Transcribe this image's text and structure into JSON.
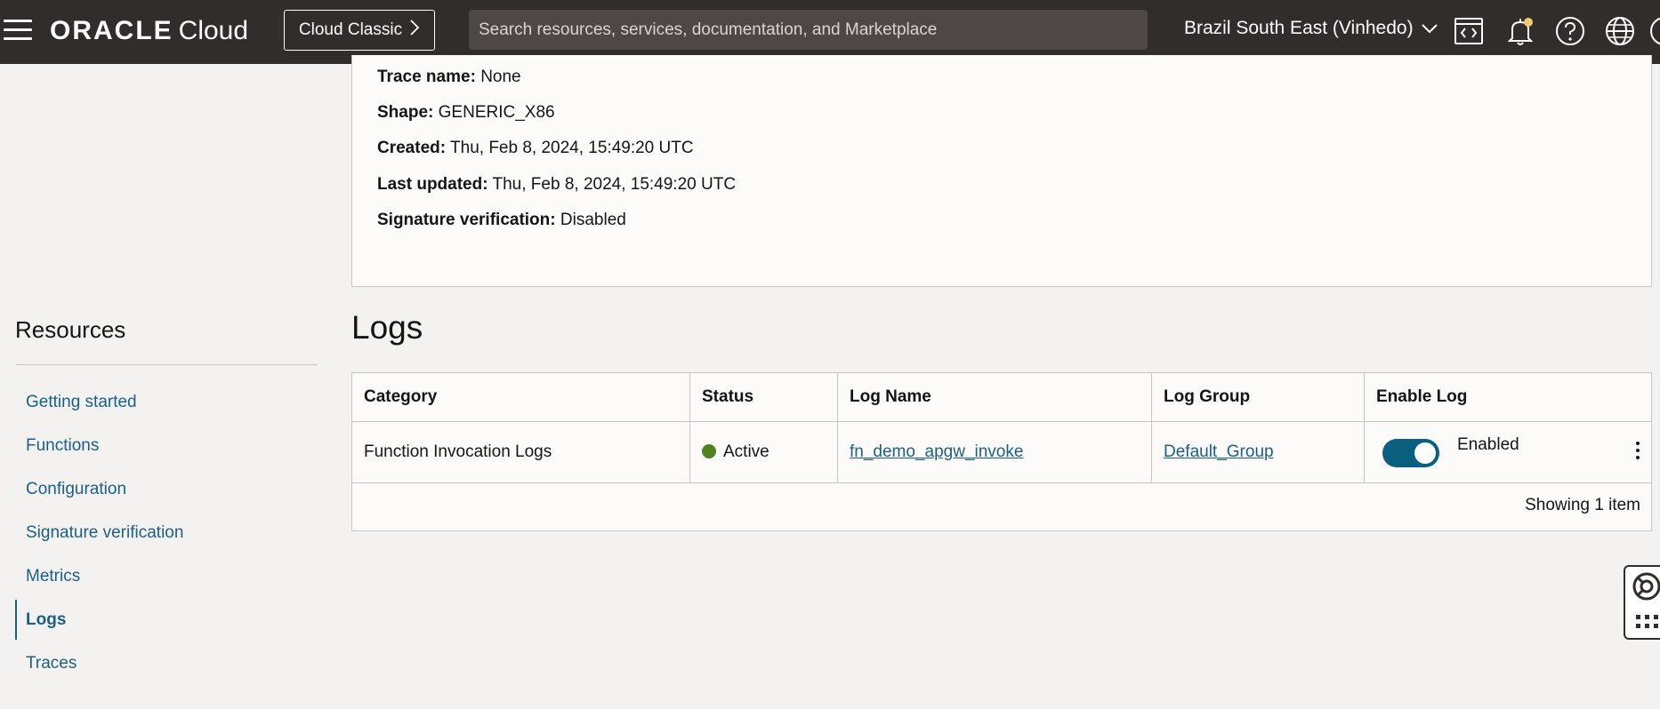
{
  "header": {
    "brand_oracle": "ORACLE",
    "brand_cloud": "Cloud",
    "classic_button": "Cloud Classic",
    "search_placeholder": "Search resources, services, documentation, and Marketplace",
    "region": "Brazil South East (Vinhedo)",
    "icons": [
      "menu-icon",
      "code-editor-icon",
      "bell-icon",
      "help-icon",
      "globe-icon"
    ]
  },
  "details": {
    "trace_name": {
      "label": "Trace name:",
      "value": "None"
    },
    "shape": {
      "label": "Shape:",
      "value": "GENERIC_X86"
    },
    "created": {
      "label": "Created:",
      "value": "Thu, Feb 8, 2024, 15:49:20 UTC"
    },
    "last_updated": {
      "label": "Last updated:",
      "value": "Thu, Feb 8, 2024, 15:49:20 UTC"
    },
    "signature_verification": {
      "label": "Signature verification:",
      "value": "Disabled"
    }
  },
  "resources": {
    "title": "Resources",
    "items": [
      {
        "label": "Getting started",
        "active": false
      },
      {
        "label": "Functions",
        "active": false
      },
      {
        "label": "Configuration",
        "active": false
      },
      {
        "label": "Signature verification",
        "active": false
      },
      {
        "label": "Metrics",
        "active": false
      },
      {
        "label": "Logs",
        "active": true
      },
      {
        "label": "Traces",
        "active": false
      }
    ]
  },
  "logs": {
    "title": "Logs",
    "columns": [
      "Category",
      "Status",
      "Log Name",
      "Log Group",
      "Enable Log"
    ],
    "rows": [
      {
        "category": "Function Invocation Logs",
        "status": "Active",
        "log_name": "fn_demo_apgw_invoke",
        "log_group": "Default_Group",
        "enable_log": "Enabled",
        "enabled": true
      }
    ],
    "footer": "Showing 1 item"
  },
  "colors": {
    "header_bg": "#312d2a",
    "link": "#1c5f85",
    "toggle_on": "#0a5f7f",
    "status_active": "#508223",
    "notification_dot": "#f0cc71"
  }
}
